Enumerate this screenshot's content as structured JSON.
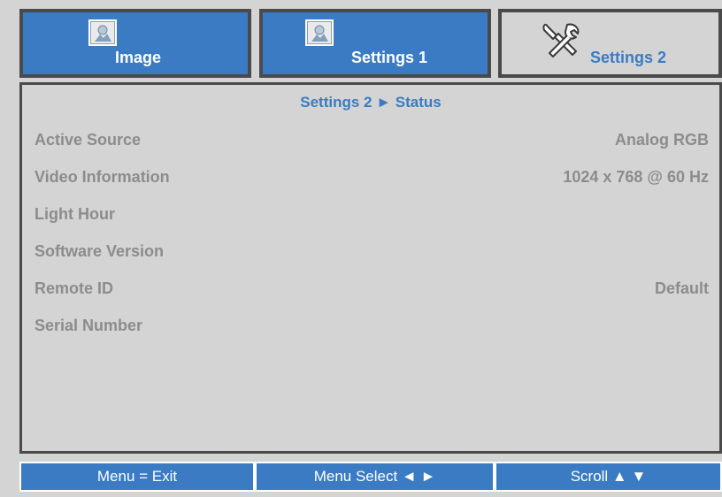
{
  "tabs": [
    {
      "label": "Image",
      "icon": "image-icon"
    },
    {
      "label": "Settings 1",
      "icon": "image-icon"
    },
    {
      "label": "Settings 2",
      "icon": "tools-icon"
    }
  ],
  "panel": {
    "title": "Settings 2 ► Status",
    "rows": [
      {
        "key": "Active Source",
        "value": "Analog RGB"
      },
      {
        "key": "Video Information",
        "value": "1024 x 768 @ 60 Hz"
      },
      {
        "key": "Light Hour",
        "value": ""
      },
      {
        "key": "Software Version",
        "value": ""
      },
      {
        "key": "Remote ID",
        "value": "Default"
      },
      {
        "key": "Serial Number",
        "value": ""
      }
    ]
  },
  "footer": {
    "exit": "Menu = Exit",
    "select": "Menu Select ◄ ►",
    "scroll": "Scroll ▲ ▼"
  },
  "colors": {
    "accent": "#3a7bc3",
    "panel_bg": "#d4d4d4",
    "border": "#4a4a4a",
    "muted_text": "#8c8c8c"
  }
}
